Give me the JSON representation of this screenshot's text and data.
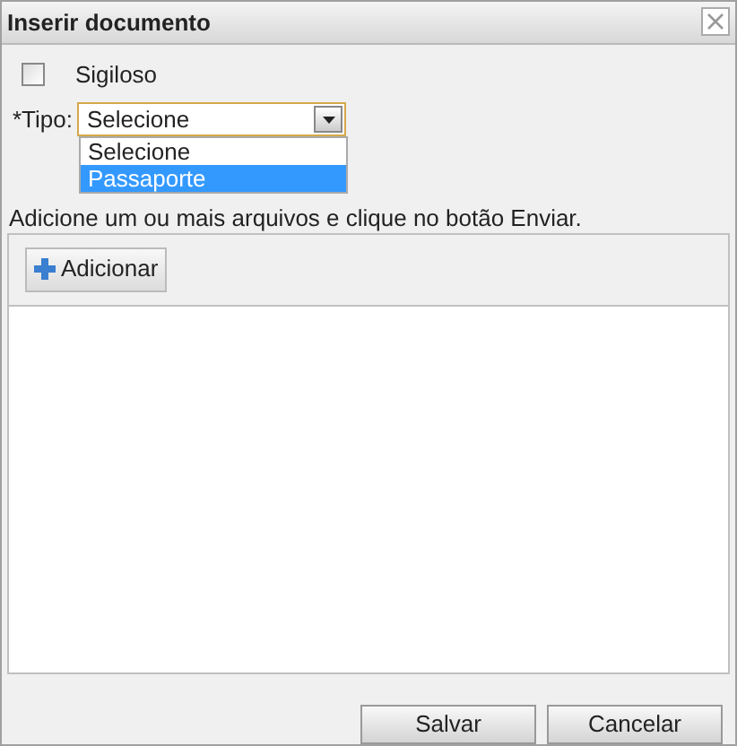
{
  "window": {
    "title": "Inserir documento"
  },
  "confidential": {
    "label": "Sigiloso",
    "checked": false
  },
  "type_field": {
    "label": "*Tipo:",
    "value": "Selecione",
    "expanded": true,
    "options": [
      {
        "label": "Selecione",
        "highlighted": false
      },
      {
        "label": "Passaporte",
        "highlighted": true
      }
    ]
  },
  "instructions": "Adicione um ou mais arquivos e clique no botão Enviar.",
  "upload_panel": {
    "add_button": "Adicionar"
  },
  "buttons": [
    "Salvar",
    "Cancelar"
  ]
}
